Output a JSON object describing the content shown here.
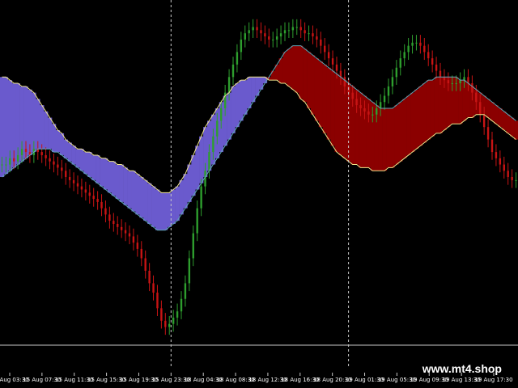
{
  "chart_data": {
    "type": "candlestick",
    "background": "#000000",
    "grid": false,
    "legend": "none",
    "colors": {
      "bull_candle": "#2e9e2e",
      "bear_candle": "#c81414",
      "bear_cloud": "#8b0000",
      "bull_cloud": "#6a5acd",
      "fast_ma": "#f0e68c",
      "slow_ma": "#5fa8b8",
      "period_separator": "#c8c8c8",
      "axis_line": "#c8c8c8",
      "text": "#ffffff"
    },
    "period_separators_x": [
      "15 Aug 23:30",
      "18 Aug 20:30"
    ],
    "x_tick_labels": [
      "15 Aug 03:30",
      "15 Aug 07:30",
      "15 Aug 11:30",
      "15 Aug 15:30",
      "15 Aug 19:30",
      "15 Aug 23:30",
      "18 Aug 04:30",
      "18 Aug 08:30",
      "18 Aug 12:30",
      "18 Aug 16:30",
      "18 Aug 20:30",
      "19 Aug 01:30",
      "19 Aug 05:30",
      "19 Aug 09:30",
      "19 Aug 13:30",
      "19 Aug 17:30"
    ],
    "price_index": [
      52,
      52,
      54,
      53,
      55,
      57,
      56,
      55,
      57,
      56,
      55,
      54,
      53,
      52,
      51,
      50,
      48,
      47,
      46,
      45,
      44,
      43,
      42,
      41,
      40,
      38,
      36,
      34,
      33,
      32,
      31,
      30,
      29,
      27,
      25,
      22,
      18,
      14,
      11,
      6,
      2,
      0,
      1,
      3,
      5,
      9,
      14,
      22,
      30,
      38,
      45,
      50,
      56,
      61,
      66,
      70,
      75,
      80,
      84,
      88,
      92,
      94,
      95,
      96,
      95,
      94,
      93,
      92,
      92,
      93,
      94,
      95,
      95,
      96,
      96,
      95,
      94,
      94,
      93,
      92,
      90,
      88,
      86,
      84,
      82,
      80,
      77,
      75,
      73,
      71,
      70,
      69,
      68,
      68,
      70,
      72,
      74,
      77,
      80,
      83,
      86,
      88,
      90,
      91,
      91,
      90,
      88,
      86,
      84,
      82,
      80,
      79,
      78,
      78,
      78,
      79,
      80,
      78,
      75,
      72,
      68,
      64,
      60,
      56,
      54,
      52,
      50,
      48,
      47,
      47
    ],
    "fast_ma": [
      80,
      80,
      79,
      78,
      78,
      77,
      77,
      76,
      75,
      73,
      71,
      69,
      67,
      65,
      63,
      62,
      60,
      59,
      58,
      57,
      57,
      56,
      56,
      55,
      55,
      54,
      54,
      53,
      53,
      52,
      52,
      51,
      50,
      50,
      49,
      48,
      47,
      46,
      45,
      44,
      43,
      43,
      43,
      44,
      45,
      47,
      49,
      52,
      55,
      58,
      61,
      64,
      66,
      68,
      70,
      72,
      74,
      75,
      77,
      78,
      79,
      79,
      80,
      80,
      80,
      80,
      80,
      79,
      79,
      79,
      78,
      78,
      77,
      76,
      75,
      73,
      72,
      70,
      68,
      66,
      64,
      62,
      60,
      58,
      56,
      55,
      54,
      53,
      52,
      52,
      51,
      51,
      51,
      50,
      50,
      50,
      50,
      51,
      51,
      52,
      53,
      54,
      55,
      56,
      57,
      58,
      59,
      60,
      61,
      62,
      62,
      63,
      64,
      65,
      65,
      65,
      66,
      67,
      67,
      68,
      68,
      68,
      67,
      66,
      65,
      64,
      63,
      62,
      61,
      60
    ],
    "slow_ma": [
      48,
      49,
      50,
      51,
      52,
      53,
      54,
      55,
      56,
      57,
      57,
      57,
      57,
      56,
      56,
      55,
      54,
      53,
      52,
      51,
      50,
      49,
      48,
      47,
      46,
      45,
      44,
      43,
      42,
      41,
      40,
      39,
      38,
      37,
      36,
      35,
      34,
      33,
      32,
      31,
      31,
      31,
      32,
      33,
      34,
      36,
      38,
      40,
      42,
      44,
      46,
      48,
      50,
      52,
      54,
      56,
      58,
      60,
      62,
      64,
      66,
      68,
      70,
      72,
      74,
      76,
      78,
      80,
      82,
      84,
      86,
      88,
      89,
      90,
      90,
      90,
      89,
      88,
      87,
      86,
      85,
      84,
      83,
      82,
      81,
      80,
      79,
      78,
      77,
      76,
      75,
      74,
      73,
      72,
      71,
      70,
      70,
      70,
      70,
      71,
      72,
      73,
      74,
      75,
      76,
      77,
      78,
      79,
      79,
      80,
      80,
      80,
      80,
      80,
      80,
      79,
      79,
      78,
      77,
      76,
      75,
      74,
      73,
      72,
      71,
      70,
      69,
      68,
      67,
      66
    ]
  },
  "watermark": "www.mt4.shop"
}
